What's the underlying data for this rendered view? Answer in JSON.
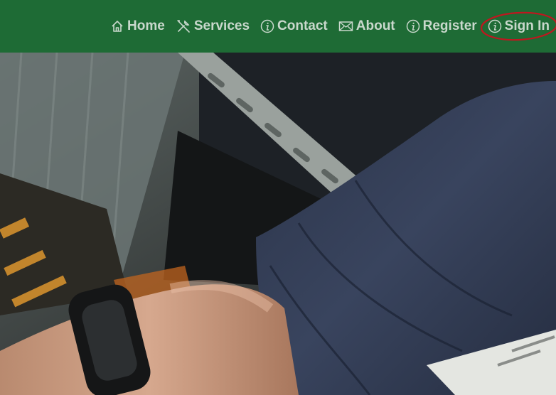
{
  "nav": {
    "items": [
      {
        "label": "Home",
        "icon": "home-icon"
      },
      {
        "label": "Services",
        "icon": "tools-icon"
      },
      {
        "label": "Contact",
        "icon": "info-icon"
      },
      {
        "label": "About",
        "icon": "envelope-icon"
      },
      {
        "label": "Register",
        "icon": "info-icon"
      },
      {
        "label": "Sign In",
        "icon": "info-icon"
      }
    ],
    "annotation_color": "#c0161f"
  },
  "colors": {
    "navbar": "#1e6b35",
    "nav_text": "#c9d8cc"
  }
}
